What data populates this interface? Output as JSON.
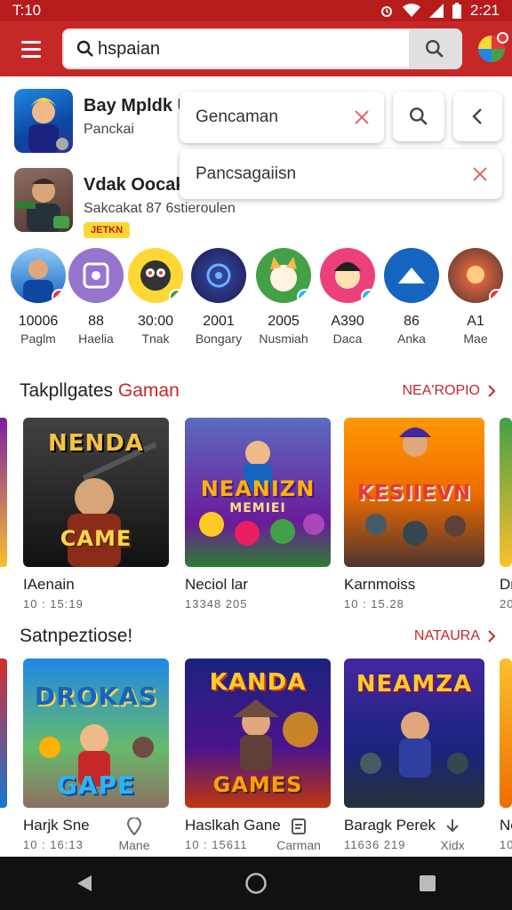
{
  "status_bar": {
    "time_left": "T:10",
    "time_right": "2:21"
  },
  "search": {
    "value": "hspaian"
  },
  "apps": [
    {
      "title": "Bay Mpldk U",
      "subtitle": "Panckai"
    },
    {
      "title": "Vdak Oocak",
      "subtitle": "Sakcakat 87 6stieroulen",
      "badge": "JETKN"
    }
  ],
  "suggestions": [
    {
      "text": "Gencaman"
    },
    {
      "text": "Pancsagaiisn"
    }
  ],
  "circles": [
    {
      "num": "10006",
      "label": "Paglm"
    },
    {
      "num": "88",
      "label": "Haelia"
    },
    {
      "num": "30:00",
      "label": "Tnak"
    },
    {
      "num": "2001",
      "label": "Bongary"
    },
    {
      "num": "2005",
      "label": "Nusmiah"
    },
    {
      "num": "A390",
      "label": "Daca"
    },
    {
      "num": "86",
      "label": "Anka"
    },
    {
      "num": "A1",
      "label": "Mae"
    }
  ],
  "section1": {
    "title_black": "Takpllgates ",
    "title_red": "Gaman",
    "link": "NEA'ROPIO",
    "cards": [
      {
        "name": "IAenain",
        "meta": "10 : 15:19",
        "art_line1": "NENDA",
        "art_line2": "CAME"
      },
      {
        "name": "Neciol lar",
        "meta": "13348 205",
        "art_line1": "NEANIZN",
        "art_line2": "MEMIEI"
      },
      {
        "name": "Karnmoiss",
        "meta": "10 : 15.28",
        "art_line1": "KESIIEVN",
        "art_line2": ""
      },
      {
        "name": "Dr",
        "meta": "20"
      }
    ]
  },
  "section2": {
    "title": "Satnpeztiose!",
    "link": "NATAURA",
    "cards": [
      {
        "name": "Harjk Sne",
        "meta": "10 : 16:13",
        "art_line1": "DROKAS",
        "art_line2": "GAPE"
      },
      {
        "name": "Haslkah Gane",
        "meta": "10 : 15611",
        "art_line1": "KANDA",
        "art_line2": "GAMES"
      },
      {
        "name": "Baragk Perek",
        "meta": "11636 219",
        "art_line1": "NEAMZA",
        "art_line2": ""
      },
      {
        "name": "Ne",
        "meta": "10"
      }
    ]
  },
  "bottom_tabs": [
    {
      "label": "Mane",
      "icon": "pin-icon"
    },
    {
      "label": "Carman",
      "icon": "document-icon"
    },
    {
      "label": "Xidx",
      "icon": "download-icon"
    }
  ]
}
